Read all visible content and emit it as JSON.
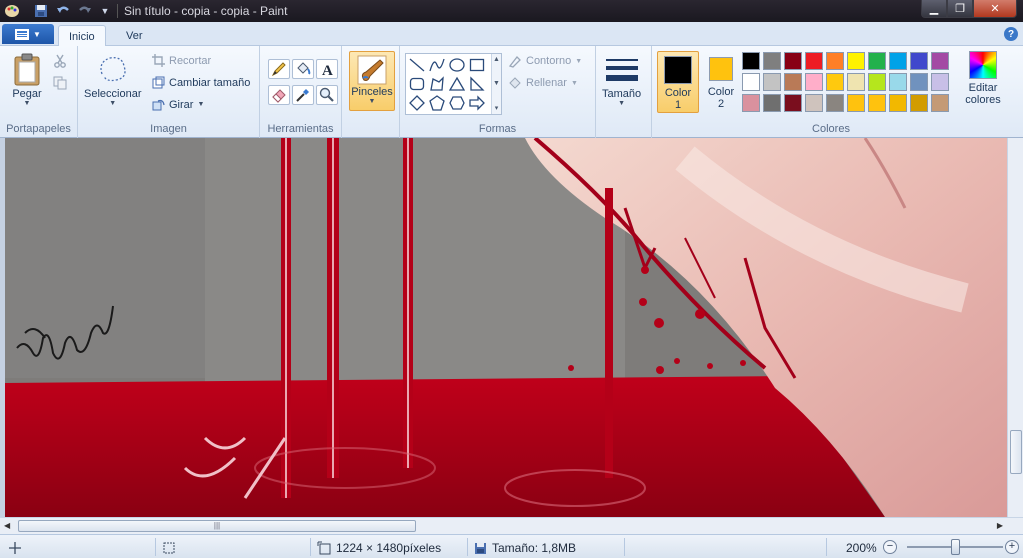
{
  "window": {
    "title": "Sin título - copia - copia - Paint"
  },
  "tabs": {
    "file_menu_icon": "paint-menu-icon",
    "items": [
      "Inicio",
      "Ver"
    ],
    "active": "Inicio"
  },
  "ribbon": {
    "portapapeles": {
      "label": "Portapapeles",
      "paste": "Pegar"
    },
    "imagen": {
      "label": "Imagen",
      "select": "Seleccionar",
      "crop": "Recortar",
      "resize": "Cambiar tamaño",
      "rotate": "Girar"
    },
    "herramientas": {
      "label": "Herramientas"
    },
    "brushes": "Pinceles",
    "formas": {
      "label": "Formas",
      "outline": "Contorno",
      "fill": "Rellenar"
    },
    "size": "Tamaño",
    "colores": {
      "label": "Colores",
      "color1": "Color\n1",
      "color1_line1": "Color",
      "color1_line2": "1",
      "color2_line1": "Color",
      "color2_line2": "2",
      "color1_value": "#000000",
      "color2_value": "#ffc20e",
      "edit_line1": "Editar",
      "edit_line2": "colores",
      "palette": [
        "#000000",
        "#7f7f7f",
        "#880015",
        "#ed1c24",
        "#ff7f27",
        "#fff200",
        "#22b14c",
        "#00a2e8",
        "#3f48cc",
        "#a349a4",
        "#ffffff",
        "#c3c3c3",
        "#b97a57",
        "#ffaec9",
        "#ffc90e",
        "#efe4b0",
        "#b5e61d",
        "#99d9ea",
        "#7092be",
        "#c8bfe7",
        "#d9919e",
        "#6f6f6f",
        "#7a0e1e",
        "#cfc3bd",
        "#8a8580",
        "#ffc20e",
        "#ffc20e",
        "#f2b800",
        "#d29c00",
        "#c49a75"
      ]
    }
  },
  "statusbar": {
    "dimensions": "1224 × 1480píxeles",
    "file_size": "Tamaño: 1,8MB",
    "zoom": "200%"
  }
}
